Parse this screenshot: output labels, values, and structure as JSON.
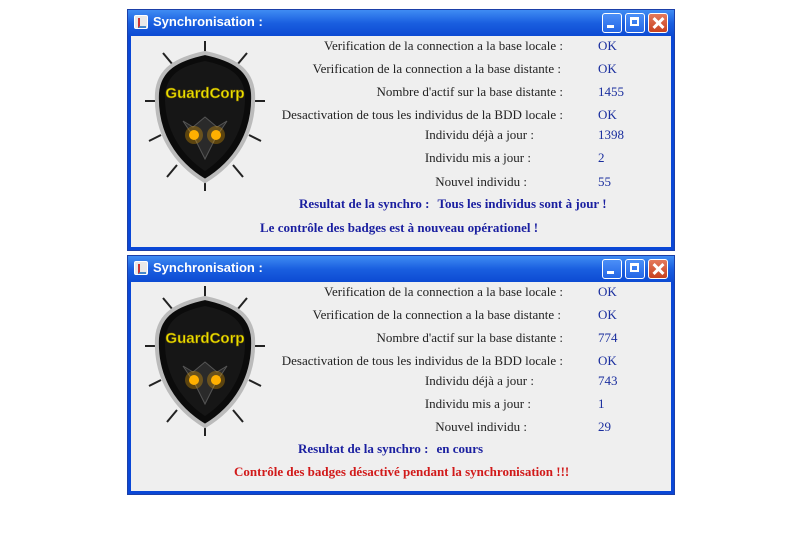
{
  "windows": [
    {
      "title": "Synchronisation :",
      "rows": [
        {
          "label": "Verification de la connection a la base locale :",
          "value": "OK"
        },
        {
          "label": "Verification de la connection a la base distante :",
          "value": "OK"
        },
        {
          "label": "Nombre d'actif sur la base distante  :",
          "value": "1455"
        },
        {
          "label": "Desactivation de tous les individus de la BDD locale :",
          "value": "OK"
        },
        {
          "label": "Individu déjà a jour :",
          "value": "1398"
        },
        {
          "label": "Individu mis a jour :",
          "value": "2"
        },
        {
          "label": "Nouvel individu :",
          "value": "55"
        }
      ],
      "status_label": "Resultat de la synchro :",
      "status_value": "Tous les individus sont à jour !",
      "message": "Le contrôle des badges est à nouveau opérationel !",
      "message_color": "#1a1fa0"
    },
    {
      "title": "Synchronisation :",
      "rows": [
        {
          "label": "Verification de la connection a la base locale :",
          "value": "OK"
        },
        {
          "label": "Verification de la connection a la base distante :",
          "value": "OK"
        },
        {
          "label": "Nombre d'actif sur la base distante  :",
          "value": "774"
        },
        {
          "label": "Desactivation de tous les individus de la BDD locale :",
          "value": "OK"
        },
        {
          "label": "Individu déjà a jour :",
          "value": "743"
        },
        {
          "label": "Individu mis a jour :",
          "value": "1"
        },
        {
          "label": "Nouvel individu :",
          "value": "29"
        }
      ],
      "status_label": "Resultat de la synchro :",
      "status_value": "en cours",
      "message": "Contrôle des badges désactivé pendant la synchronisation !!!",
      "message_color": "#d11a1a"
    }
  ],
  "logo": {
    "text": "GuardCorp",
    "icon": "guardcorp-shield-logo",
    "text_color": "#e8e000"
  },
  "icons": {
    "window": "java-cup-icon",
    "minimize": "minimize-icon",
    "maximize": "maximize-icon",
    "close": "close-icon"
  }
}
